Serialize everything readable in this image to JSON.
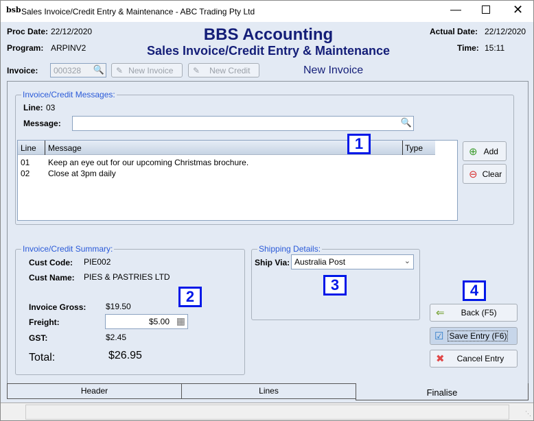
{
  "window": {
    "title": "Sales Invoice/Credit Entry & Maintenance - ABC Trading Pty Ltd"
  },
  "header": {
    "proc_date_label": "Proc Date:",
    "proc_date": "22/12/2020",
    "program_label": "Program:",
    "program": "ARPINV2",
    "app_title": "BBS Accounting",
    "subtitle": "Sales Invoice/Credit Entry & Maintenance",
    "actual_date_label": "Actual Date:",
    "actual_date": "22/12/2020",
    "time_label": "Time:",
    "time": "15:11"
  },
  "invoice": {
    "label": "Invoice:",
    "value": "000328",
    "new_invoice": "New Invoice",
    "new_credit": "New Credit",
    "mode": "New Invoice"
  },
  "messages": {
    "group": "Invoice/Credit Messages:",
    "line_label": "Line:",
    "line": "03",
    "message_label": "Message:",
    "message_value": "",
    "columns": [
      "Line",
      "Message",
      "Type"
    ],
    "rows": [
      {
        "line": "01",
        "message": "Keep an eye out for our upcoming Christmas brochure.",
        "type": ""
      },
      {
        "line": "02",
        "message": "Close at 3pm daily",
        "type": ""
      }
    ],
    "add": "Add",
    "clear": "Clear"
  },
  "summary": {
    "group": "Invoice/Credit Summary:",
    "cust_code_label": "Cust Code:",
    "cust_code": "PIE002",
    "cust_name_label": "Cust Name:",
    "cust_name": "PIES & PASTRIES LTD",
    "gross_label": "Invoice Gross:",
    "gross": "$19.50",
    "freight_label": "Freight:",
    "freight": "$5.00",
    "gst_label": "GST:",
    "gst": "$2.45",
    "total_label": "Total:",
    "total": "$26.95"
  },
  "shipping": {
    "group": "Shipping Details:",
    "ship_via_label": "Ship Via:",
    "ship_via": "Australia Post"
  },
  "actions": {
    "back": "Back (F5)",
    "save": "Save Entry (F6)",
    "cancel": "Cancel Entry"
  },
  "callouts": [
    "1",
    "2",
    "3",
    "4"
  ],
  "tabs": [
    {
      "label": "Header"
    },
    {
      "label": "Lines"
    },
    {
      "label": "Finalise",
      "active": true
    }
  ]
}
